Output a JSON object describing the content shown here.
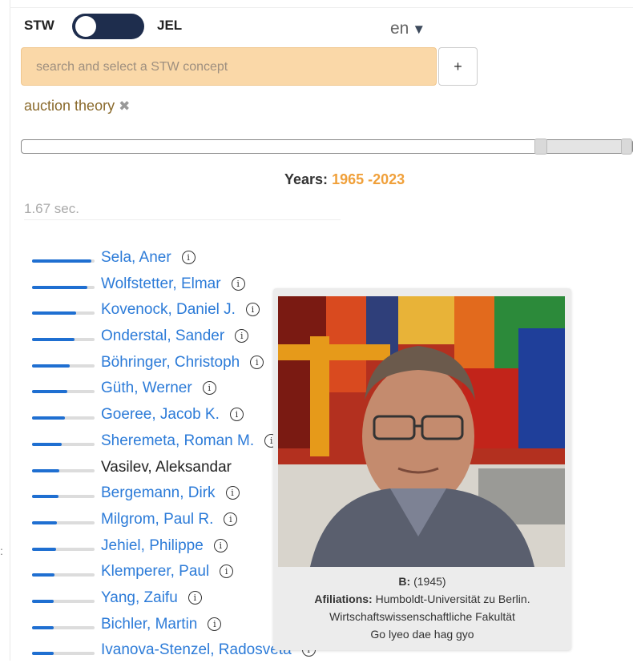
{
  "toggle": {
    "left_label": "STW",
    "right_label": "JEL"
  },
  "language": {
    "value": "en",
    "caret": "▼"
  },
  "search": {
    "placeholder": "search and select a STW concept",
    "add_label": "+"
  },
  "selected_concept": {
    "label": "auction theory",
    "remove": "✖"
  },
  "year_slider": {
    "min": 1965,
    "max": 2023,
    "selected_from": 1965,
    "selected_to": 2023
  },
  "years": {
    "label": "Years:",
    "value": "1965 -2023"
  },
  "timer": "1.67 sec.",
  "authors": [
    {
      "name": "Sela, Aner",
      "score": 0.95,
      "info": "i",
      "link": true
    },
    {
      "name": "Wolfstetter, Elmar",
      "score": 0.88,
      "info": "i",
      "link": true
    },
    {
      "name": "Kovenock, Daniel J.",
      "score": 0.7,
      "info": "i",
      "link": true
    },
    {
      "name": "Onderstal, Sander",
      "score": 0.68,
      "info": "i",
      "link": true
    },
    {
      "name": "Böhringer, Christoph",
      "score": 0.6,
      "info": "i",
      "link": true
    },
    {
      "name": "Güth, Werner",
      "score": 0.56,
      "info": "i",
      "link": true
    },
    {
      "name": "Goeree, Jacob K.",
      "score": 0.52,
      "info": "i",
      "link": true
    },
    {
      "name": "Sheremeta, Roman M.",
      "score": 0.48,
      "info": "i",
      "link": true
    },
    {
      "name": "Vasilev, Aleksandar",
      "score": 0.44,
      "info": "",
      "link": false
    },
    {
      "name": "Bergemann, Dirk",
      "score": 0.42,
      "info": "i",
      "link": true
    },
    {
      "name": "Milgrom, Paul R.",
      "score": 0.4,
      "info": "i",
      "link": true
    },
    {
      "name": "Jehiel, Philippe",
      "score": 0.38,
      "info": "i",
      "link": true
    },
    {
      "name": "Klemperer, Paul",
      "score": 0.36,
      "info": "i",
      "link": true
    },
    {
      "name": "Yang, Zaifu",
      "score": 0.34,
      "info": "i",
      "link": true
    },
    {
      "name": "Bichler, Martin",
      "score": 0.34,
      "info": "i",
      "link": true
    },
    {
      "name": "Ivanova-Stenzel, Radosveta",
      "score": 0.34,
      "info": "i",
      "link": true
    }
  ],
  "ellipsis": ":",
  "tooltip": {
    "born_label": "B:",
    "born_value": "(1945)",
    "affiliations_label": "Afiliations:",
    "affiliations_value": "Humboldt-Universität zu Berlin.",
    "affiliations_line2": "Wirtschaftswissenschaftliche Fakultät",
    "extra_line": "Go lyeo dae hag gyo"
  },
  "colors": {
    "accent": "#1f6fd1",
    "link": "#2c7bd8",
    "years": "#f0a03a",
    "toggle": "#1e2d4d",
    "search_bg": "#fad8a8"
  }
}
